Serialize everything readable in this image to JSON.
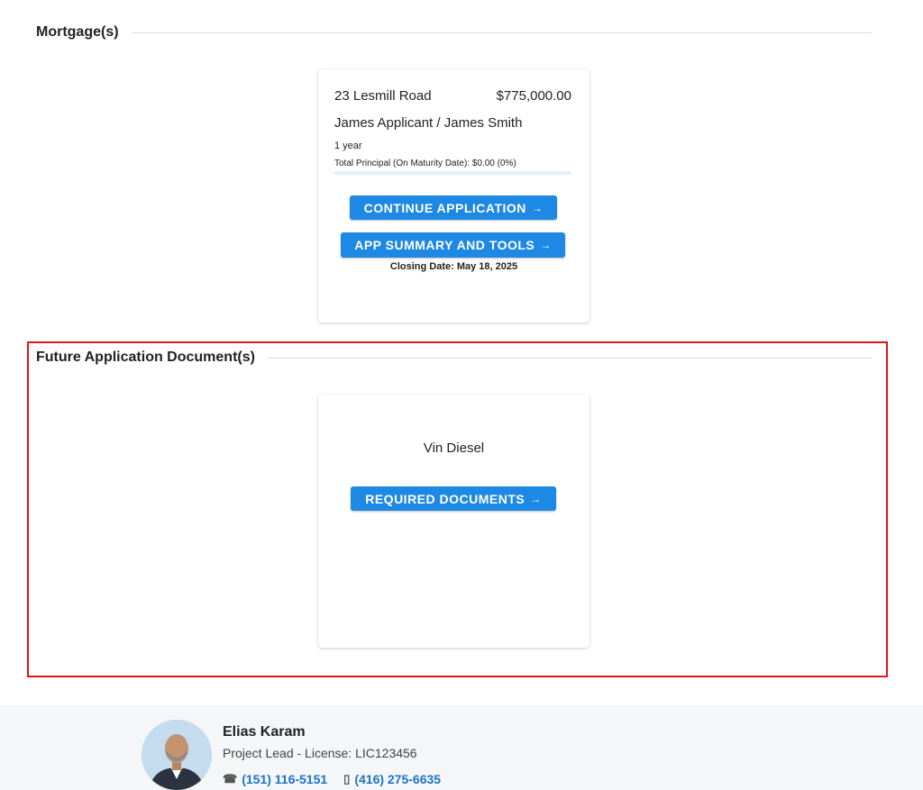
{
  "mortgages": {
    "title": "Mortgage(s)",
    "card": {
      "address": "23 Lesmill Road",
      "amount": "$775,000.00",
      "applicants": "James Applicant / James Smith",
      "term": "1 year",
      "principal": "Total Principal (On Maturity Date): $0.00 (0%)",
      "progress": 0,
      "continue_label": "CONTINUE APPLICATION",
      "summary_label": "APP SUMMARY AND TOOLS",
      "arrow": "→",
      "closing_date": "Closing Date: May 18, 2025"
    }
  },
  "future_docs": {
    "title": "Future Application Document(s)",
    "card": {
      "name": "Vin Diesel",
      "required_label": "REQUIRED DOCUMENTS"
    }
  },
  "contact": {
    "name": "Elias Karam",
    "role": "Project Lead - License: LIC123456",
    "phone_icon": "☎",
    "phone": "(151) 116-5151",
    "mobile_icon": "▯",
    "mobile": "(416) 275-6635"
  },
  "colors": {
    "accent": "#1e88e5",
    "highlight_border": "#e0141e",
    "link": "#1e73c8"
  }
}
